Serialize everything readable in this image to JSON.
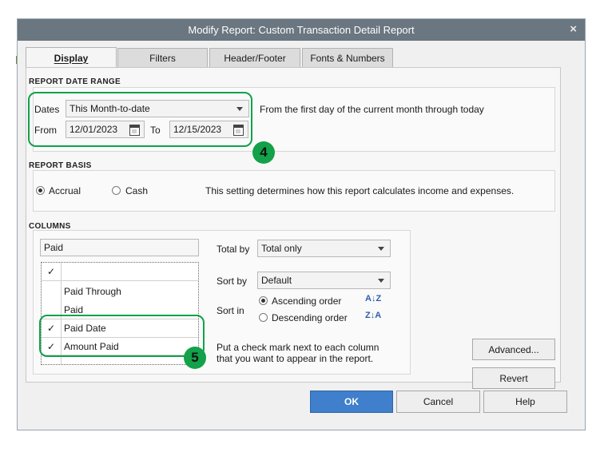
{
  "window": {
    "title": "Modify Report: Custom Transaction Detail Report",
    "close": "×"
  },
  "tabs": [
    "Display",
    "Filters",
    "Header/Footer",
    "Fonts & Numbers"
  ],
  "date_range": {
    "section_label": "REPORT DATE RANGE",
    "dates_label": "Dates",
    "dates_value": "This Month-to-date",
    "description": "From the first day of the current month through today",
    "from_label": "From",
    "from_value": "12/01/2023",
    "to_label": "To",
    "to_value": "12/15/2023"
  },
  "basis": {
    "section_label": "REPORT BASIS",
    "accrual_label": "Accrual",
    "cash_label": "Cash",
    "selected": "Accrual",
    "description": "This setting determines how this report calculates income and expenses."
  },
  "columns": {
    "section_label": "COLUMNS",
    "search_value": "Paid",
    "header_check": "✓",
    "items": [
      {
        "label": "Paid Through",
        "checked": false,
        "check": ""
      },
      {
        "label": "Paid",
        "checked": false,
        "check": ""
      },
      {
        "label": "Paid Date",
        "checked": true,
        "check": "✓"
      },
      {
        "label": "Amount Paid",
        "checked": true,
        "check": "✓"
      }
    ],
    "total_by_label": "Total by",
    "total_by_value": "Total only",
    "sort_by_label": "Sort by",
    "sort_by_value": "Default",
    "sort_in_label": "Sort in",
    "ascending_label": "Ascending order",
    "descending_label": "Descending order",
    "sort_selected": "Ascending order",
    "hint": "Put a check mark next to each column that you want to appear in the report."
  },
  "side_buttons": {
    "advanced": "Advanced...",
    "revert": "Revert"
  },
  "footer": {
    "ok": "OK",
    "cancel": "Cancel",
    "help": "Help"
  },
  "annotations": {
    "step4": "4",
    "step5": "5"
  },
  "colors": {
    "accent_green": "#13a14a",
    "ok_blue": "#3f7fcb",
    "titlebar": "#6a7680"
  }
}
